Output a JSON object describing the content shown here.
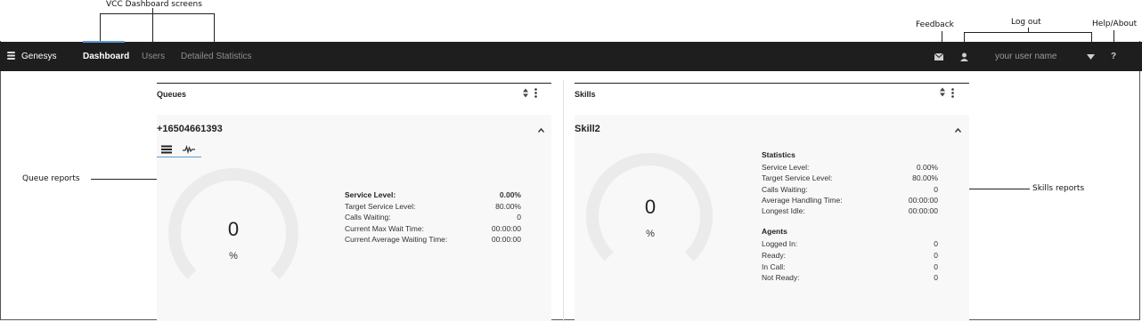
{
  "annotations": {
    "vcc_dashboard_screens": "VCC Dashboard screens",
    "feedback": "Feedback",
    "log_out": "Log out",
    "help_about": "Help/About",
    "queue_reports": "Queue reports",
    "skills_reports": "Skills reports"
  },
  "topbar": {
    "brand": "Genesys",
    "tabs": [
      "Dashboard",
      "Users",
      "Detailed Statistics"
    ],
    "active_tab": "Dashboard",
    "user_name": "your user name",
    "help_glyph": "?",
    "icons": [
      "menu-icon",
      "envelope-icon",
      "user-icon",
      "caret-down-icon"
    ]
  },
  "queues": {
    "title": "Queues",
    "queue_name": "+16504661393",
    "gauge_value": "0",
    "gauge_unit": "%",
    "stats": [
      {
        "label": "Service Level:",
        "value": "0.00%"
      },
      {
        "label": "Target Service Level:",
        "value": "80.00%"
      },
      {
        "label": "Calls Waiting:",
        "value": "0"
      },
      {
        "label": "Current Max Wait Time:",
        "value": "00:00:00"
      },
      {
        "label": "Current Average Waiting Time:",
        "value": "00:00:00"
      }
    ]
  },
  "skills": {
    "title": "Skills",
    "skill_name": "Skill2",
    "gauge_value": "0",
    "gauge_unit": "%",
    "statistics_heading": "Statistics",
    "statistics": [
      {
        "label": "Service Level:",
        "value": "0.00%"
      },
      {
        "label": "Target Service Level:",
        "value": "80.00%"
      },
      {
        "label": "Calls Waiting:",
        "value": "0"
      },
      {
        "label": "Average Handling Time:",
        "value": "00:00:00"
      },
      {
        "label": "Longest Idle:",
        "value": "00:00:00"
      }
    ],
    "agents_heading": "Agents",
    "agents": [
      {
        "label": "Logged In:",
        "value": "0"
      },
      {
        "label": "Ready:",
        "value": "0"
      },
      {
        "label": "In Call:",
        "value": "0"
      },
      {
        "label": "Not Ready:",
        "value": "0"
      }
    ]
  },
  "colors": {
    "topbar_bg": "#1e1e1e",
    "tab_accent": "#5b9bd5",
    "panel_bg": "#f8f8f8",
    "gauge_ring": "#ebebeb"
  }
}
